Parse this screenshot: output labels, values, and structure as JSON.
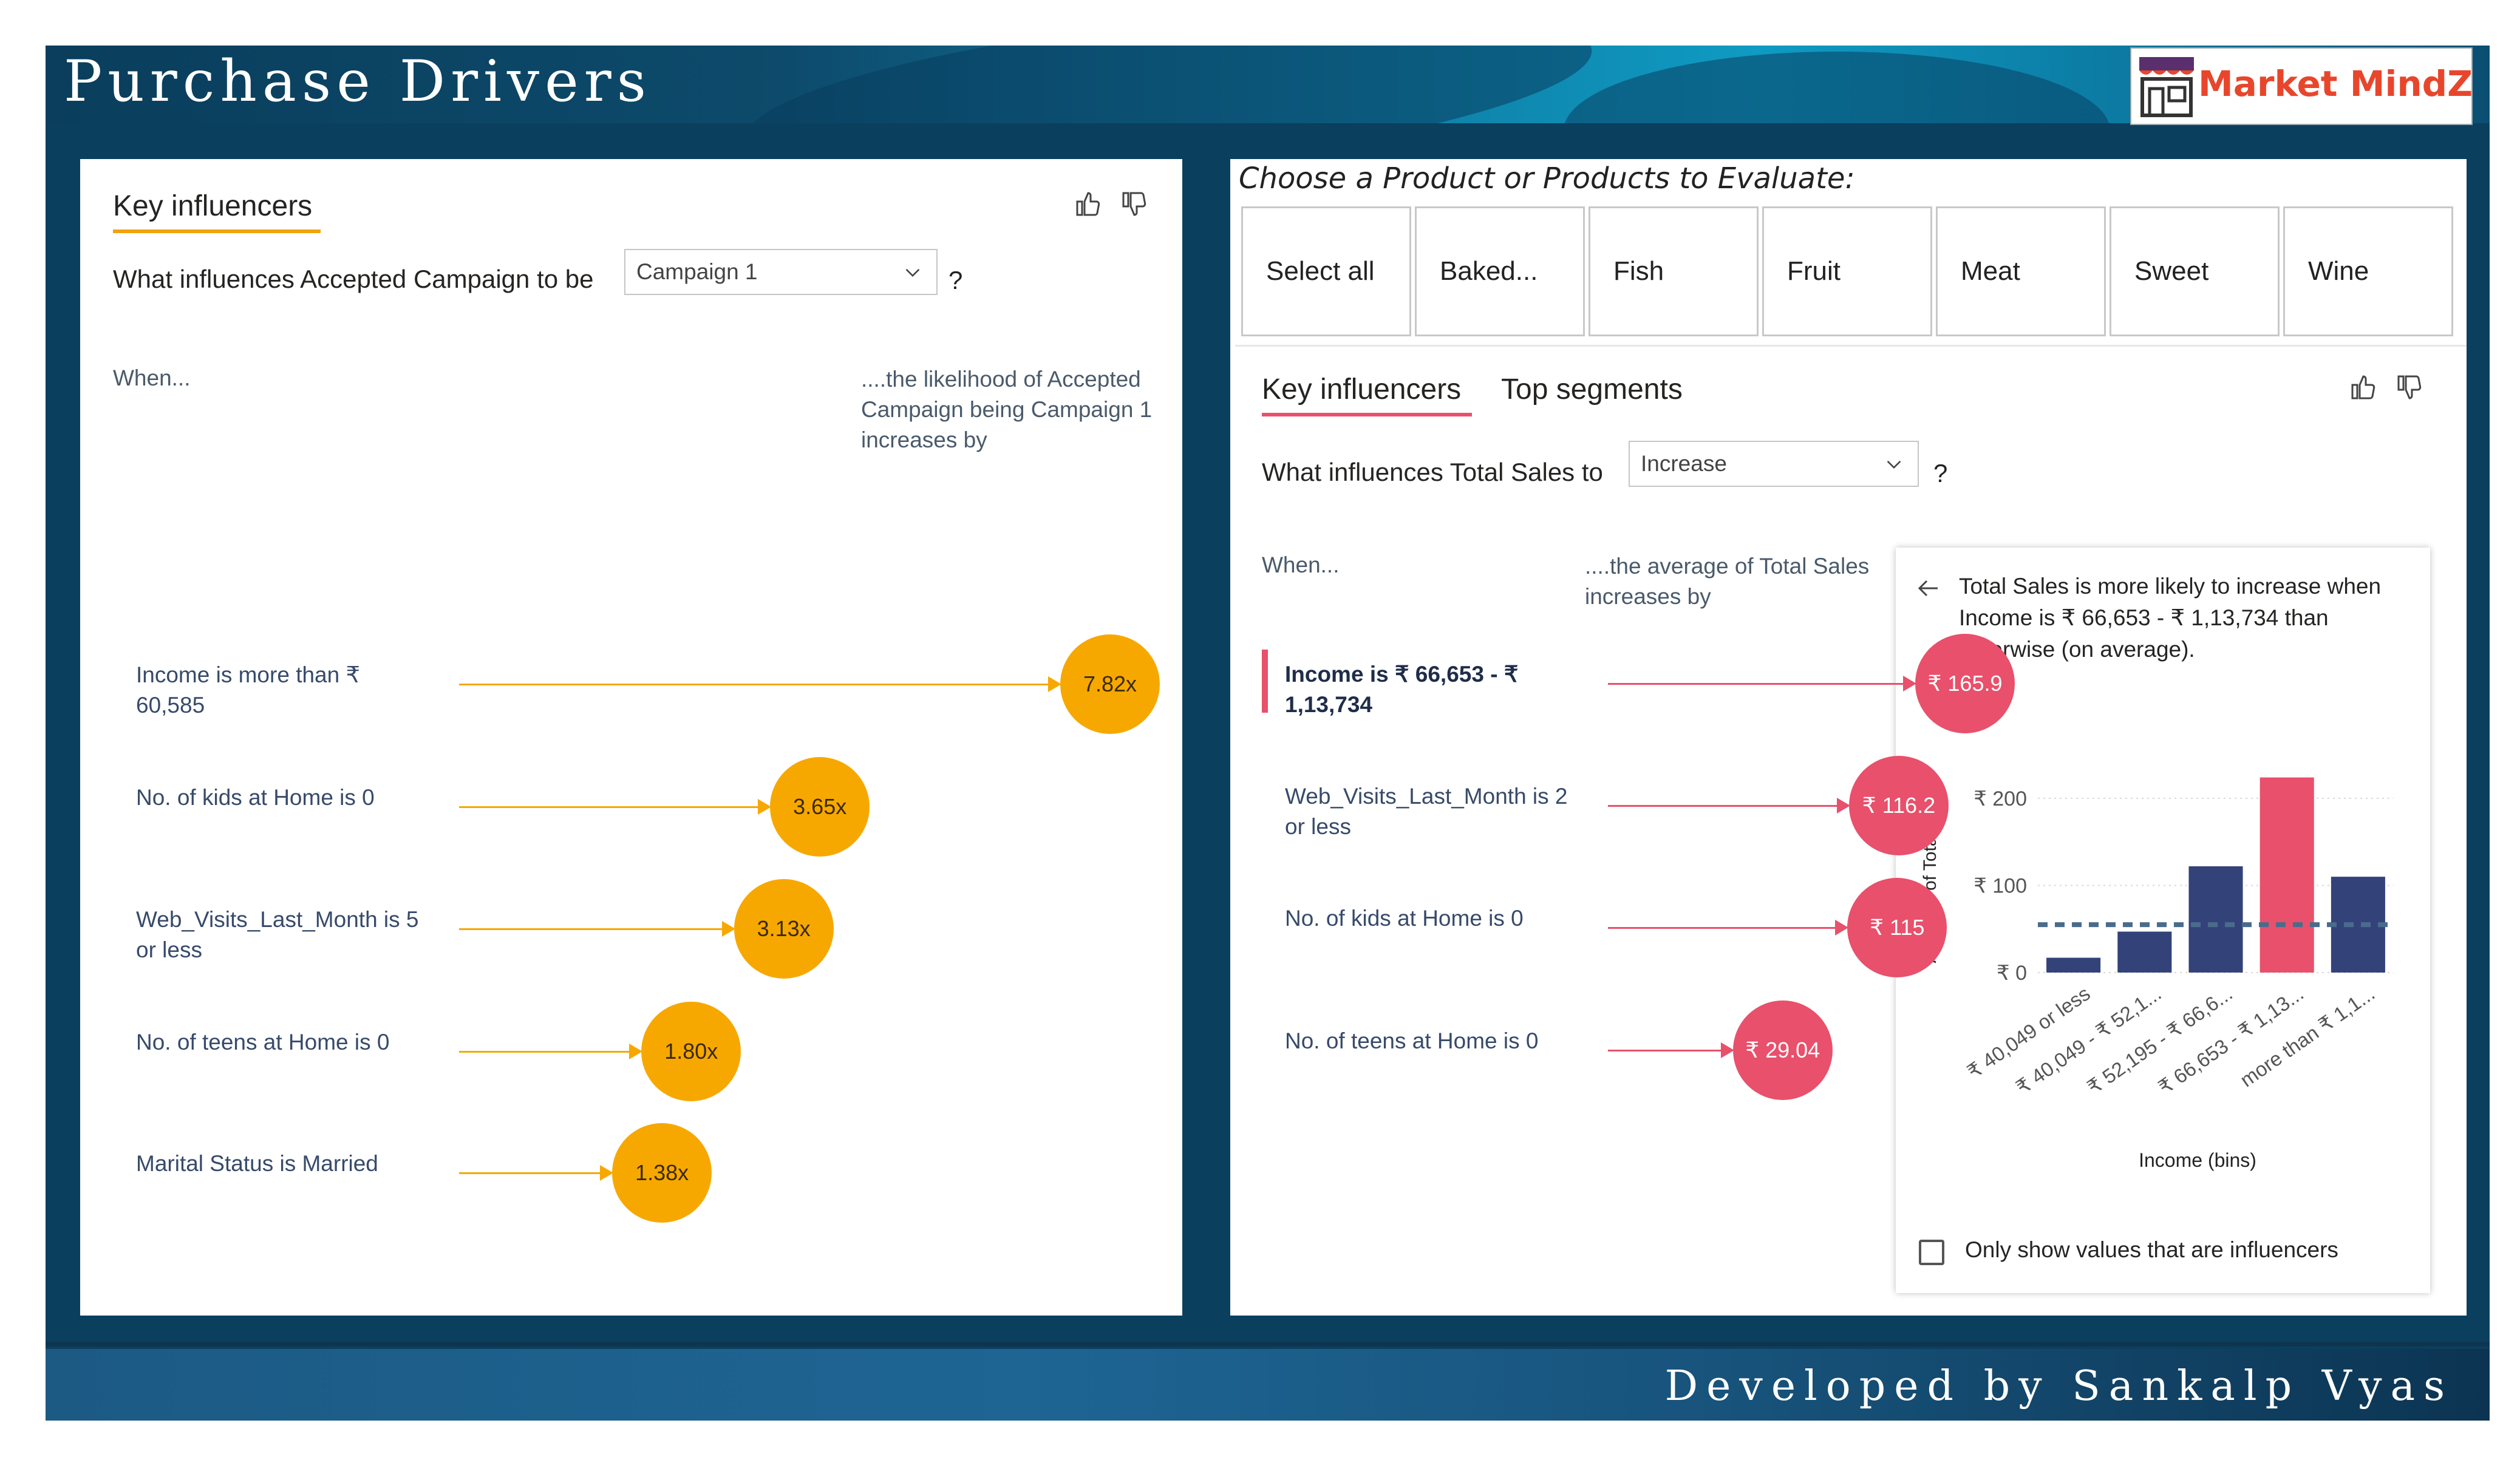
{
  "header": {
    "title": "Purchase Drivers",
    "logo_text": "Market MindZ"
  },
  "footer": {
    "credit": "Developed by Sankalp Vyas"
  },
  "left_panel": {
    "tab": "Key influencers",
    "question_prefix": "What influences Accepted Campaign to be",
    "dropdown_value": "Campaign 1",
    "question_suffix": "?",
    "when_label": "When...",
    "effect_label": "....the likelihood of Accepted Campaign being Campaign 1 increases by",
    "influencers": [
      {
        "label": "Income is more than ₹ 60,585",
        "value": "7.82x",
        "factor": 7.82
      },
      {
        "label": "No. of kids at Home is 0",
        "value": "3.65x",
        "factor": 3.65
      },
      {
        "label": "Web_Visits_Last_Month is 5 or less",
        "value": "3.13x",
        "factor": 3.13
      },
      {
        "label": "No. of teens at Home is 0",
        "value": "1.80x",
        "factor": 1.8
      },
      {
        "label": "Marital Status is Married",
        "value": "1.38x",
        "factor": 1.38
      }
    ],
    "colors": {
      "bubble": "#f7a800",
      "underline": "#f2a20c"
    }
  },
  "right_panel": {
    "slicer_title": "Choose a Product or Products to Evaluate:",
    "slicer_options": [
      "Select all",
      "Baked...",
      "Fish",
      "Fruit",
      "Meat",
      "Sweet",
      "Wine"
    ],
    "tabs": [
      "Key influencers",
      "Top segments"
    ],
    "question_prefix": "What influences Total Sales to",
    "dropdown_value": "Increase",
    "question_suffix": "?",
    "when_label": "When...",
    "effect_label": "....the average of Total Sales increases by",
    "influencers": [
      {
        "label": "Income is ₹ 66,653 - ₹ 1,13,734",
        "value": "₹ 165.9",
        "amount": 165.9,
        "selected": true
      },
      {
        "label": "Web_Visits_Last_Month is 2 or less",
        "value": "₹ 116.2",
        "amount": 116.2
      },
      {
        "label": "No. of kids at Home is 0",
        "value": "₹ 115",
        "amount": 115
      },
      {
        "label": "No. of teens at Home is 0",
        "value": "₹ 29.04",
        "amount": 29.04
      }
    ],
    "detail": {
      "back_icon": "arrow-left-icon",
      "text": "Total Sales is more likely to increase when Income is ₹ 66,653 - ₹ 1,13,734 than otherwise (on average).",
      "checkbox_label": "Only show values that are influencers"
    },
    "colors": {
      "bubble": "#e8506b",
      "bar": "#34427a",
      "bar_highlight": "#e8506b"
    }
  },
  "chart_data": {
    "type": "bar",
    "title": "",
    "xlabel": "Income (bins)",
    "ylabel": "Average of Total Sales",
    "categories": [
      "₹ 40,049 or less",
      "₹ 40,049 - ₹ 52,1...",
      "₹ 52,195 - ₹ 66,6...",
      "₹ 66,653 - ₹ 1,13...",
      "more than ₹ 1,1..."
    ],
    "values": [
      17,
      47,
      122,
      224,
      110
    ],
    "highlight_index": 3,
    "average_line": 55,
    "yticks": [
      "₹ 0",
      "₹ 100",
      "₹ 200"
    ],
    "ytick_values": [
      0,
      100,
      200
    ],
    "ylim": [
      0,
      230
    ]
  }
}
